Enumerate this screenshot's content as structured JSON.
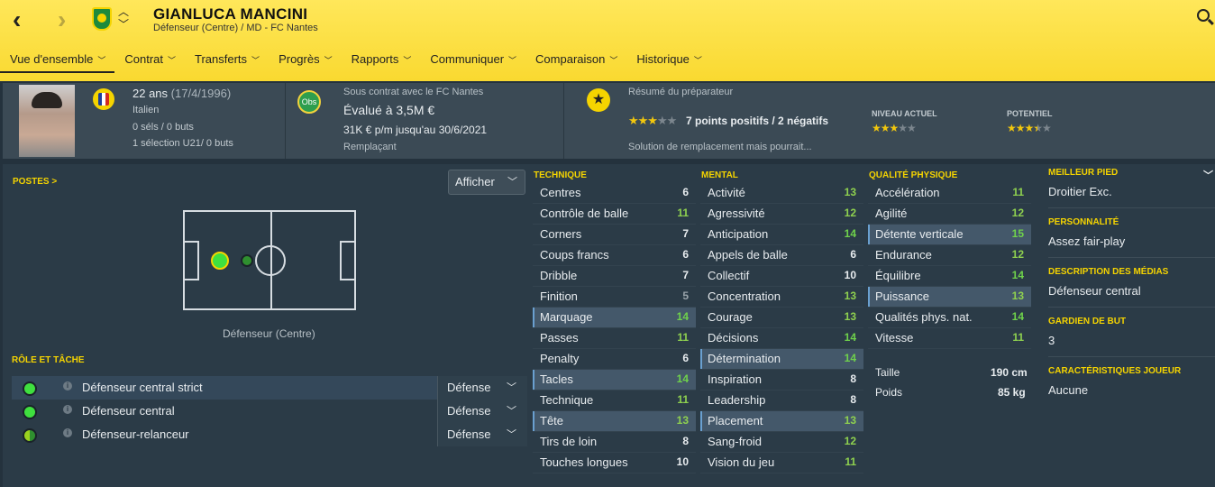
{
  "header": {
    "name": "GIANLUCA MANCINI",
    "subtitle": "Défenseur (Centre) / MD - FC Nantes",
    "back": "‹",
    "forward": "›"
  },
  "nav": [
    {
      "label": "Vue d'ensemble",
      "active": true
    },
    {
      "label": "Contrat"
    },
    {
      "label": "Transferts"
    },
    {
      "label": "Progrès"
    },
    {
      "label": "Rapports"
    },
    {
      "label": "Communiquer"
    },
    {
      "label": "Comparaison"
    },
    {
      "label": "Historique"
    }
  ],
  "bio": {
    "age": "22 ans",
    "dob": "(17/4/1996)",
    "nationality": "Italien",
    "caps": "0 séls / 0 buts",
    "u21": "1 sélection U21/ 0 buts"
  },
  "contract": {
    "line1": "Sous contrat avec le FC Nantes",
    "value": "Évalué à 3,5M €",
    "wage": "31K € p/m jusqu'au 30/6/2021",
    "status": "Remplaçant",
    "badge": "Obs"
  },
  "scout": {
    "title": "Résumé du préparateur",
    "points": "7 points positifs / 2 négatifs",
    "summary": "Solution de remplacement mais pourrait...",
    "current_label": "NIVEAU ACTUEL",
    "potential_label": "POTENTIEL",
    "summary_stars": 3,
    "current_stars": 3,
    "potential_stars": 3.5
  },
  "positions": {
    "title": "POSTES >",
    "show": "Afficher",
    "label": "Défenseur (Centre)"
  },
  "roles": {
    "title": "RÔLE ET TÂCHE",
    "items": [
      {
        "name": "Défenseur central strict",
        "duty": "Défense",
        "color": "#3fe03f"
      },
      {
        "name": "Défenseur central",
        "duty": "Défense",
        "color": "#3fe03f"
      },
      {
        "name": "Défenseur-relanceur",
        "duty": "Défense",
        "color": "#9ad11e"
      }
    ]
  },
  "technique": {
    "title": "TECHNIQUE",
    "items": [
      [
        "Centres",
        "6"
      ],
      [
        "Contrôle de balle",
        "11"
      ],
      [
        "Corners",
        "7"
      ],
      [
        "Coups francs",
        "6"
      ],
      [
        "Dribble",
        "7"
      ],
      [
        "Finition",
        "5"
      ],
      [
        "Marquage",
        "14"
      ],
      [
        "Passes",
        "11"
      ],
      [
        "Penalty",
        "6"
      ],
      [
        "Tacles",
        "14"
      ],
      [
        "Technique",
        "11"
      ],
      [
        "Tête",
        "13"
      ],
      [
        "Tirs de loin",
        "8"
      ],
      [
        "Touches longues",
        "10"
      ]
    ]
  },
  "mental": {
    "title": "MENTAL",
    "items": [
      [
        "Activité",
        "13"
      ],
      [
        "Agressivité",
        "12"
      ],
      [
        "Anticipation",
        "14"
      ],
      [
        "Appels de balle",
        "6"
      ],
      [
        "Collectif",
        "10"
      ],
      [
        "Concentration",
        "13"
      ],
      [
        "Courage",
        "13"
      ],
      [
        "Décisions",
        "14"
      ],
      [
        "Détermination",
        "14"
      ],
      [
        "Inspiration",
        "8"
      ],
      [
        "Leadership",
        "8"
      ],
      [
        "Placement",
        "13"
      ],
      [
        "Sang-froid",
        "12"
      ],
      [
        "Vision du jeu",
        "11"
      ]
    ]
  },
  "physical": {
    "title": "QUALITÉ PHYSIQUE",
    "items": [
      [
        "Accélération",
        "11"
      ],
      [
        "Agilité",
        "12"
      ],
      [
        "Détente verticale",
        "15"
      ],
      [
        "Endurance",
        "12"
      ],
      [
        "Équilibre",
        "14"
      ],
      [
        "Puissance",
        "13"
      ],
      [
        "Qualités phys. nat.",
        "14"
      ],
      [
        "Vitesse",
        "11"
      ]
    ],
    "height_label": "Taille",
    "height": "190 cm",
    "weight_label": "Poids",
    "weight": "85 kg"
  },
  "side": {
    "foot_label": "MEILLEUR PIED",
    "foot": "Droitier Exc.",
    "personality_label": "PERSONNALITÉ",
    "personality": "Assez fair-play",
    "media_label": "DESCRIPTION DES MÉDIAS",
    "media": "Défenseur central",
    "gk_label": "GARDIEN DE BUT",
    "gk": "3",
    "traits_label": "CARACTÉRISTIQUES JOUEUR",
    "traits": "Aucune"
  }
}
